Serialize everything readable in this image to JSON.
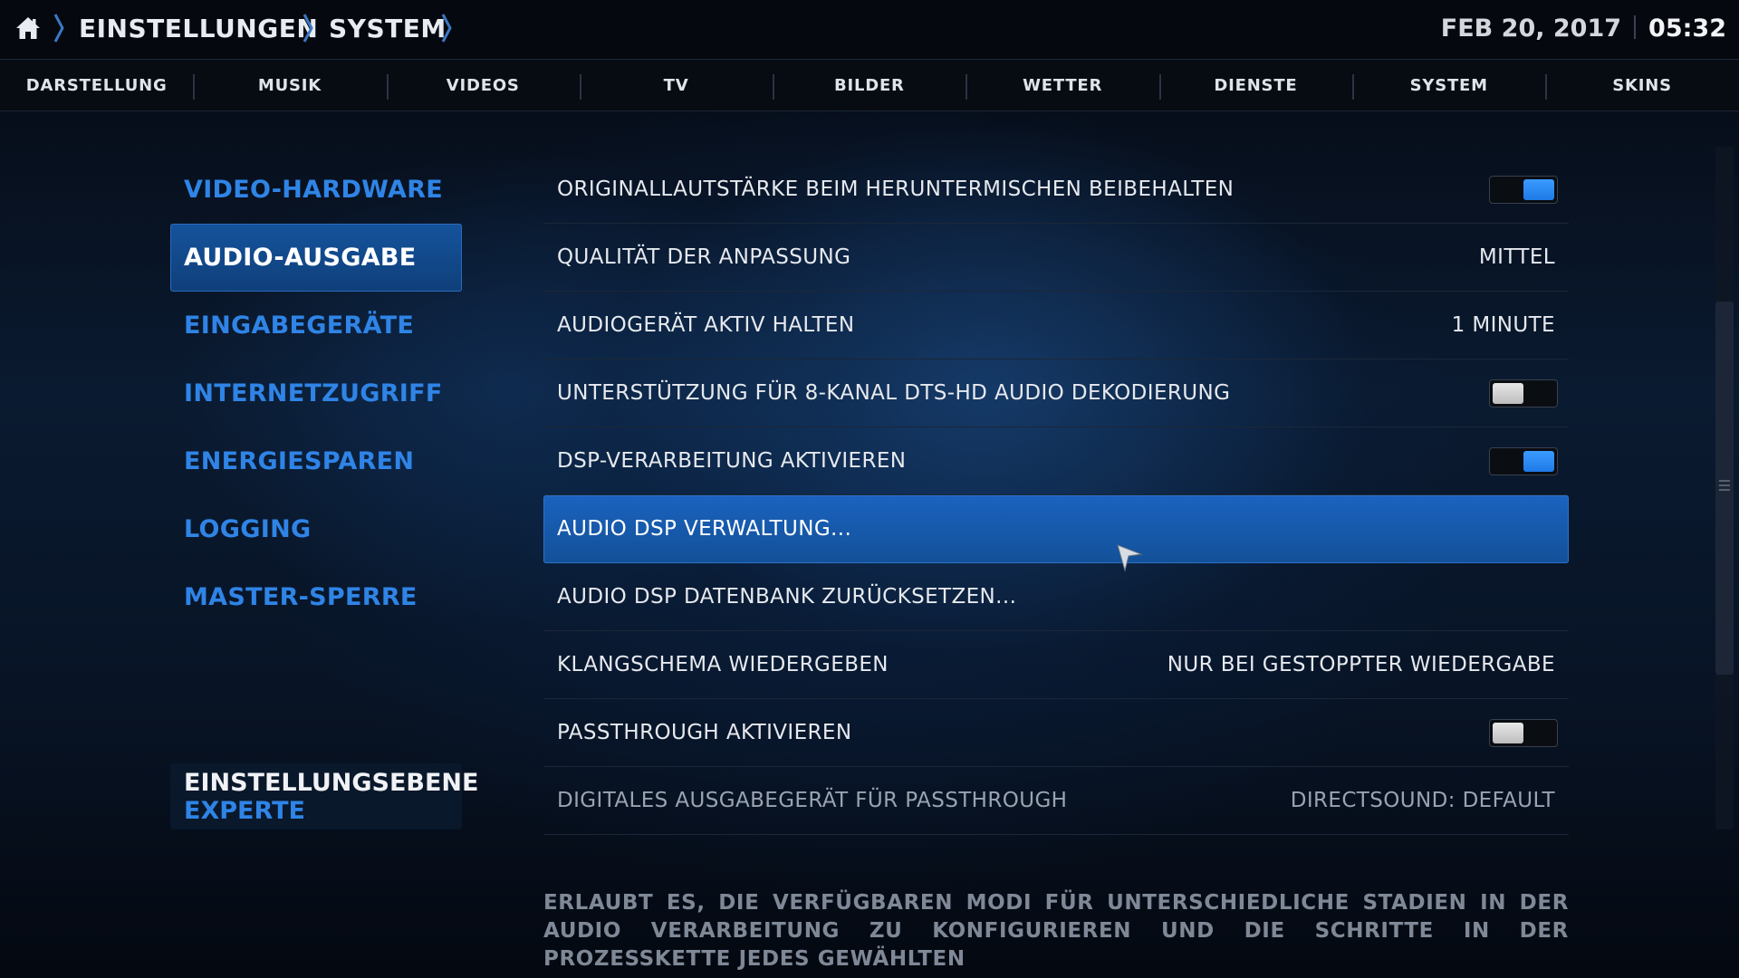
{
  "header": {
    "breadcrumbs": [
      "EINSTELLUNGEN",
      "SYSTEM"
    ],
    "date": "FEB 20, 2017",
    "time": "05:32"
  },
  "nav": {
    "items": [
      "DARSTELLUNG",
      "MUSIK",
      "VIDEOS",
      "TV",
      "BILDER",
      "WETTER",
      "DIENSTE",
      "SYSTEM",
      "SKINS"
    ]
  },
  "menu": {
    "items": [
      "VIDEO-HARDWARE",
      "AUDIO-AUSGABE",
      "EINGABEGERÄTE",
      "INTERNETZUGRIFF",
      "ENERGIESPAREN",
      "LOGGING",
      "MASTER-SPERRE"
    ],
    "active_index": 1
  },
  "level": {
    "title": "EINSTELLUNGSEBENE",
    "value": "EXPERTE"
  },
  "settings": [
    {
      "label": "ORIGINALLAUTSTÄRKE BEIM HERUNTERMISCHEN BEIBEHALTEN",
      "toggle": true
    },
    {
      "label": "QUALITÄT DER ANPASSUNG",
      "value": "MITTEL"
    },
    {
      "label": "AUDIOGERÄT AKTIV HALTEN",
      "value": "1 MINUTE"
    },
    {
      "label": "UNTERSTÜTZUNG FÜR 8-KANAL DTS-HD AUDIO DEKODIERUNG",
      "toggle": false
    },
    {
      "label": "DSP-VERARBEITUNG AKTIVIEREN",
      "toggle": true
    },
    {
      "label": "AUDIO DSP VERWALTUNG..."
    },
    {
      "label": "AUDIO DSP DATENBANK ZURÜCKSETZEN..."
    },
    {
      "label": "KLANGSCHEMA WIEDERGEBEN",
      "value": "NUR BEI GESTOPPTER WIEDERGABE"
    },
    {
      "label": "PASSTHROUGH AKTIVIEREN",
      "toggle": false
    },
    {
      "label": "DIGITALES AUSGABEGERÄT FÜR PASSTHROUGH",
      "value": "DIRECTSOUND: DEFAULT"
    }
  ],
  "description": "ERLAUBT ES, DIE VERFÜGBAREN MODI FÜR UNTERSCHIEDLICHE STADIEN IN DER AUDIO VERARBEITUNG ZU KONFIGURIEREN UND DIE SCHRITTE IN DER PROZESSKETTE JEDES GEWÄHLTEN",
  "icons": {
    "home": "home-icon",
    "breadcrumb_separator": "chevron-right-icon",
    "cursor": "mouse-pointer-icon"
  },
  "colors": {
    "accent": "#2f84e6",
    "highlight": "#1a63bf",
    "toggle_on": "#2a8cf5",
    "toggle_off": "#d0d0d0"
  }
}
